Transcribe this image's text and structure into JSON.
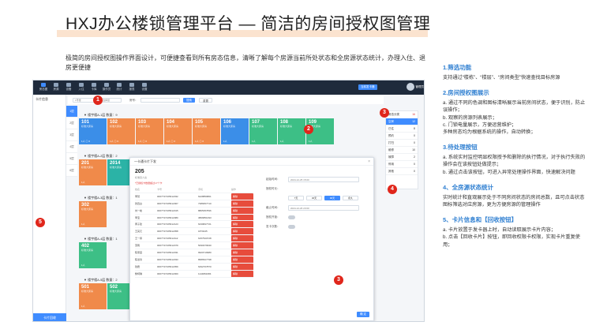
{
  "header": {
    "title": "HXJ办公楼锁管理平台 — 简洁的房间授权图管理",
    "intro": "极简的房间授权图操作界面设计，可便捷查看到所有房态信息，清晰了解每个房源当前所处状态和全房源状态统计，办理入住、退房更便捷"
  },
  "screenshot": {
    "topnav": [
      "房态图",
      "房源",
      "设备",
      "入住",
      "卡库",
      "操作员",
      "统计",
      "报表",
      "设置"
    ],
    "topbar_buttons": [
      "当前发卡器"
    ],
    "user_name": "管理员",
    "left_title": "卡片信息",
    "left_footer": "卡片回收",
    "toolbar": {
      "building_placeholder": "1号楼",
      "floor_placeholder": "请选择层",
      "room_label": "房号：",
      "search_label": "搜索",
      "reset_label": "重置"
    },
    "floors": [
      "1层",
      "2层",
      "3层",
      "4层",
      "5层",
      "6层"
    ],
    "sections": [
      {
        "head": "▼ 楼宇楼A-1层  数量：9",
        "rooms": [
          {
            "num": "101",
            "status": "标准大床房",
            "meta": "1人  ⓘ 0",
            "color": "c-blue"
          },
          {
            "num": "102",
            "status": "标准大床房",
            "meta": "1人  ⓘ 0",
            "color": "c-orange"
          },
          {
            "num": "103",
            "status": "标准大床房",
            "meta": "1人  ⓘ 0",
            "color": "c-orange"
          },
          {
            "num": "104",
            "status": "标准大床房",
            "meta": "1人  ⓘ 0",
            "color": "c-orange"
          },
          {
            "num": "105",
            "status": "标准大床房",
            "meta": "1人  ⓘ 0",
            "color": "c-orange"
          },
          {
            "num": "106",
            "status": "标准大床房",
            "meta": "1人",
            "color": "c-blue"
          },
          {
            "num": "107",
            "status": "标准大床房",
            "meta": "1人",
            "color": "c-green"
          },
          {
            "num": "108",
            "status": "标准大床房",
            "meta": "1人",
            "color": "c-green"
          },
          {
            "num": "109",
            "status": "标准大床房",
            "meta": "1人",
            "color": "c-green"
          }
        ]
      },
      {
        "head": "▼ 楼宇楼A-2层  数量：2",
        "rooms": [
          {
            "num": "201",
            "status": "标准大床房",
            "meta": "1人",
            "color": "c-orange"
          },
          {
            "num": "2014",
            "status": "标准大床房",
            "meta": "",
            "color": "c-teal"
          }
        ]
      },
      {
        "head": "▼ 楼宇楼A-3层  数量：1",
        "rooms": [
          {
            "num": "302",
            "status": "标准大床房",
            "meta": "1人",
            "color": "c-orange"
          }
        ]
      },
      {
        "head": "▼ 楼宇楼A-4层  数量：1",
        "rooms": [
          {
            "num": "402",
            "status": "标准大床房",
            "meta": "1人",
            "color": "c-green"
          }
        ]
      },
      {
        "head": "▼ 楼宇楼A-5层  数量：2",
        "rooms": [
          {
            "num": "501",
            "status": "标准大床房",
            "meta": "1人",
            "color": "c-orange"
          },
          {
            "num": "502",
            "status": "标准大床房",
            "meta": "",
            "color": "c-green"
          }
        ]
      }
    ],
    "rightpanel": {
      "title": "房态分类",
      "title_badge": "16",
      "rows": [
        {
          "label": "空房",
          "count": "12"
        },
        {
          "label": "已住",
          "count": "8"
        },
        {
          "label": "预约",
          "count": "0"
        },
        {
          "label": "打扫",
          "count": "0"
        },
        {
          "label": "维修",
          "count": "10"
        },
        {
          "label": "故障",
          "count": "2"
        },
        {
          "label": "停用",
          "count": "0"
        },
        {
          "label": "其他",
          "count": "0"
        }
      ]
    },
    "modal": {
      "title": "一卡通卡片下发",
      "room": "205",
      "sub": "标准双人房",
      "hint": "*已授权卡数量超过17个卡",
      "table_head": [
        "姓名",
        "卡号",
        "手机",
        "操作"
      ],
      "rows": [
        [
          "李慧",
          "0007737165612032",
          "6228859861",
          "解除"
        ],
        [
          "张四白",
          "0007737165612007",
          "7386657710",
          "解除"
        ],
        [
          "刘一峰",
          "0007737165612015",
          "8805357836",
          "解除"
        ],
        [
          "李宝",
          "0007737165612080",
          "3866851093",
          "解除"
        ],
        [
          "黄子建",
          "0007737165612123",
          "6239847721",
          "解除"
        ],
        [
          "王亮元",
          "0007737165612058",
          "1870245",
          "解除"
        ],
        [
          "王一昂",
          "0007737165612112",
          "6157520728",
          "解除"
        ],
        [
          "萧雨",
          "0007737165612079",
          "5090379930",
          "解除"
        ],
        [
          "陈家园",
          "0007737165612031",
          "9920719980",
          "解除"
        ],
        [
          "陈淑清",
          "0007737165612033",
          "8686527798",
          "解除"
        ],
        [
          "钱霞",
          "0007737165612059",
          "6492707870",
          "解除"
        ],
        [
          "黎柯琪",
          "0007737165612060",
          "1144891684",
          "解除"
        ]
      ],
      "form": {
        "start_label": "起始时间：",
        "start_value": "2024-12-25   15:00",
        "duration_label": "授权时长：",
        "pills": [
          "7天",
          "30天",
          "90天",
          "永久"
        ],
        "end_label": "截止时间：",
        "end_value": "2024-12-26   23:00",
        "toggle1_label": "授权开锁：",
        "toggle2_label": "发卡次数："
      },
      "confirm": "确 定"
    }
  },
  "markers": [
    "1",
    "2",
    "3",
    "4",
    "5",
    "3"
  ],
  "notes": [
    {
      "title": "1.筛选功能",
      "lines": [
        "支持通过“楼栋”、“楼层”、“房间类型”快速查找目标房源"
      ]
    },
    {
      "title": "2.房间授权图展示",
      "lines": [
        "a. 通过不同的色调和图标清晰展示当前房间状态，便于识别，防止误操作；",
        "b. 观察的房源列表展示；",
        "c. 门锁电量展示，方便运营维护；",
        "多种房态均为根据系统的操作，自动转换；"
      ]
    },
    {
      "title": "3.待处理按钮",
      "lines": [
        "a. 系统实时监控明显权限授予和删除的执行情况，对于执行失败的操作会在该按钮处做提示；",
        "b. 通过点击该按钮，可进入异常处理操作界面，快速解决问题"
      ]
    },
    {
      "title": "4、全房源状态统计",
      "lines": [
        "实时统计和直观展示处于不同房间状态的房间总数，且可点击状态图标筛选对应房源，更为方便房源的管理操作"
      ]
    },
    {
      "title": "5、卡片信息和【回收按钮】",
      "lines": [
        "a. 卡片放置于发卡器上时，自动读取展示卡片内容；",
        "b. 点击【回收卡片】按钮，即回收权限卡权限，实现卡片重复使用；"
      ]
    }
  ]
}
